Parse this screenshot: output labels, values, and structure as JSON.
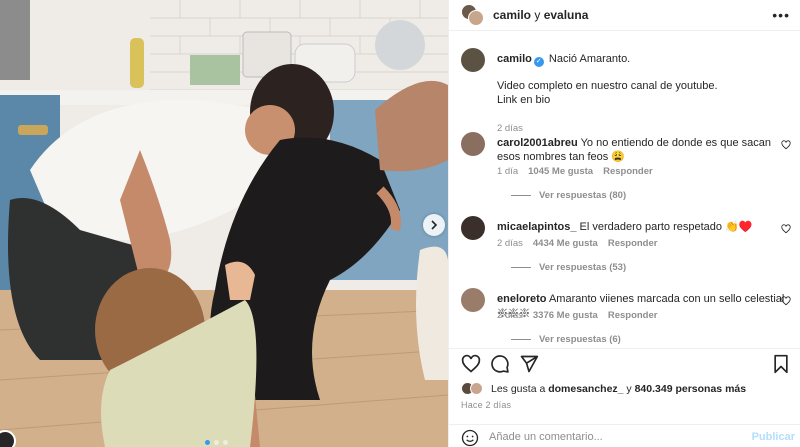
{
  "post": {
    "header_user1": "camilo",
    "header_sep": "y",
    "header_user2": "evaluna",
    "more_label": "•••"
  },
  "caption": {
    "username": "camilo",
    "verified_mark": "✓",
    "line1": "Nació Amaranto.",
    "line2": "Video completo en nuestro canal de youtube.",
    "line3": "Link en bio",
    "time": "2 días"
  },
  "comments": [
    {
      "username": "carol2001abreu",
      "text": "Yo no entiendo de donde es que sacan esos nombres tan feos 😩",
      "time": "1 día",
      "likes": "1045 Me gusta",
      "reply": "Responder",
      "view_replies": "Ver respuestas (80)"
    },
    {
      "username": "micaelapintos_",
      "text": "El verdadero parto respetado 👏♥️",
      "time": "2 días",
      "likes": "4434 Me gusta",
      "reply": "Responder",
      "view_replies": "Ver respuestas (53)"
    },
    {
      "username": "eneloreto",
      "text": "Amaranto viienes marcada con un sello celestial 𑗕𑗕𑗕",
      "time": "2 días",
      "likes": "3376 Me gusta",
      "reply": "Responder",
      "view_replies": "Ver respuestas (6)"
    }
  ],
  "likes": {
    "prefix": "Les gusta a",
    "user": "domesanchez_",
    "middle": "y",
    "count": "840.349 personas más"
  },
  "posted_ago": "Hace 2 días",
  "add_comment": {
    "placeholder": "Añade un comentario...",
    "publish": "Publicar"
  },
  "carousel": {
    "slides": 3,
    "active_index": 0
  },
  "colors": {
    "accent": "#3897f0",
    "heart": "#e0245e",
    "muted": "#8e8e8e"
  },
  "icons": [
    "heart-icon",
    "comment-icon",
    "share-icon",
    "bookmark-icon",
    "emoji-icon",
    "chevron-right-icon",
    "more-icon"
  ]
}
